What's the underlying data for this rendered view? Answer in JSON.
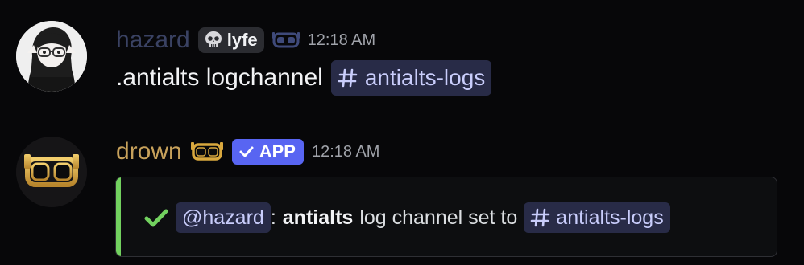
{
  "messages": [
    {
      "author": "hazard",
      "tag": {
        "label": "lyfe",
        "icon": "skull-icon"
      },
      "role_icon": "goggles-icon",
      "timestamp": "12:18 AM",
      "content": {
        "text": ".antialts logchannel",
        "channel_mention": "antialts-logs"
      }
    },
    {
      "author": "drown",
      "role_icon": "goggles-icon",
      "app_badge": "APP",
      "timestamp": "12:18 AM",
      "embed": {
        "accent_color": "#72d15f",
        "icon": "check-icon",
        "user_mention": "@hazard",
        "separator": ":",
        "bold_text": "antialts",
        "text": "log channel set to",
        "channel_mention": "antialts-logs"
      }
    }
  ]
}
